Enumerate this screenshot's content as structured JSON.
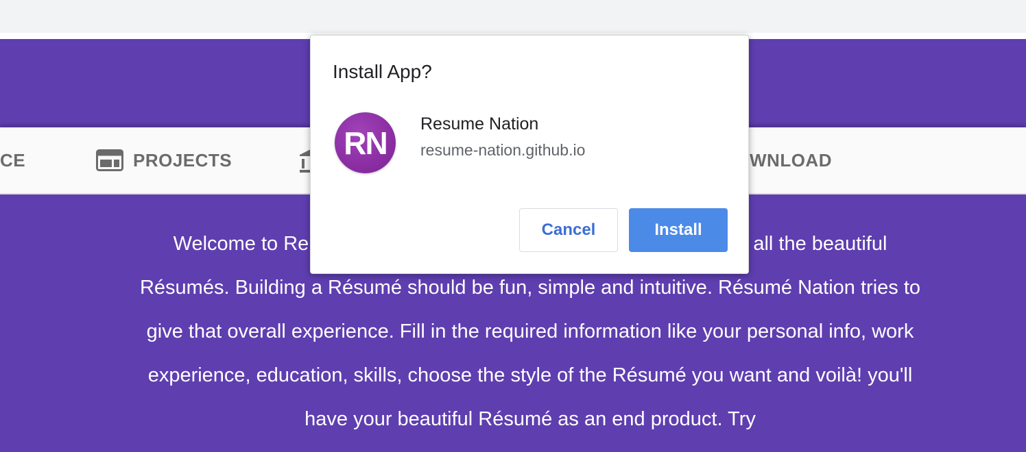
{
  "nav": {
    "items": [
      {
        "label": "CE",
        "icon": "none"
      },
      {
        "label": "PROJECTS",
        "icon": "web-icon"
      },
      {
        "label": "",
        "icon": "bank-icon"
      },
      {
        "label": "WNLOAD",
        "icon": "none"
      }
    ]
  },
  "content": {
    "welcome_line1_left": "Welcome to Re",
    "welcome_line1_right": "all the beautiful",
    "welcome_rest": "Résumés. Building a Résumé should be fun, simple and intuitive. Résumé Nation tries to give that overall experience. Fill in the required information like your personal info, work experience, education, skills, choose the style of the Résumé you want and voilà! you'll have your beautiful Résumé as an end product. Try"
  },
  "dialog": {
    "title": "Install App?",
    "app_logo_text": "RN",
    "app_name": "Resume Nation",
    "app_url": "resume-nation.github.io",
    "cancel_label": "Cancel",
    "install_label": "Install"
  },
  "colors": {
    "brand_purple": "#5f3eb0",
    "install_blue": "#4c8ae8",
    "logo_purple": "#8b2ea3"
  }
}
